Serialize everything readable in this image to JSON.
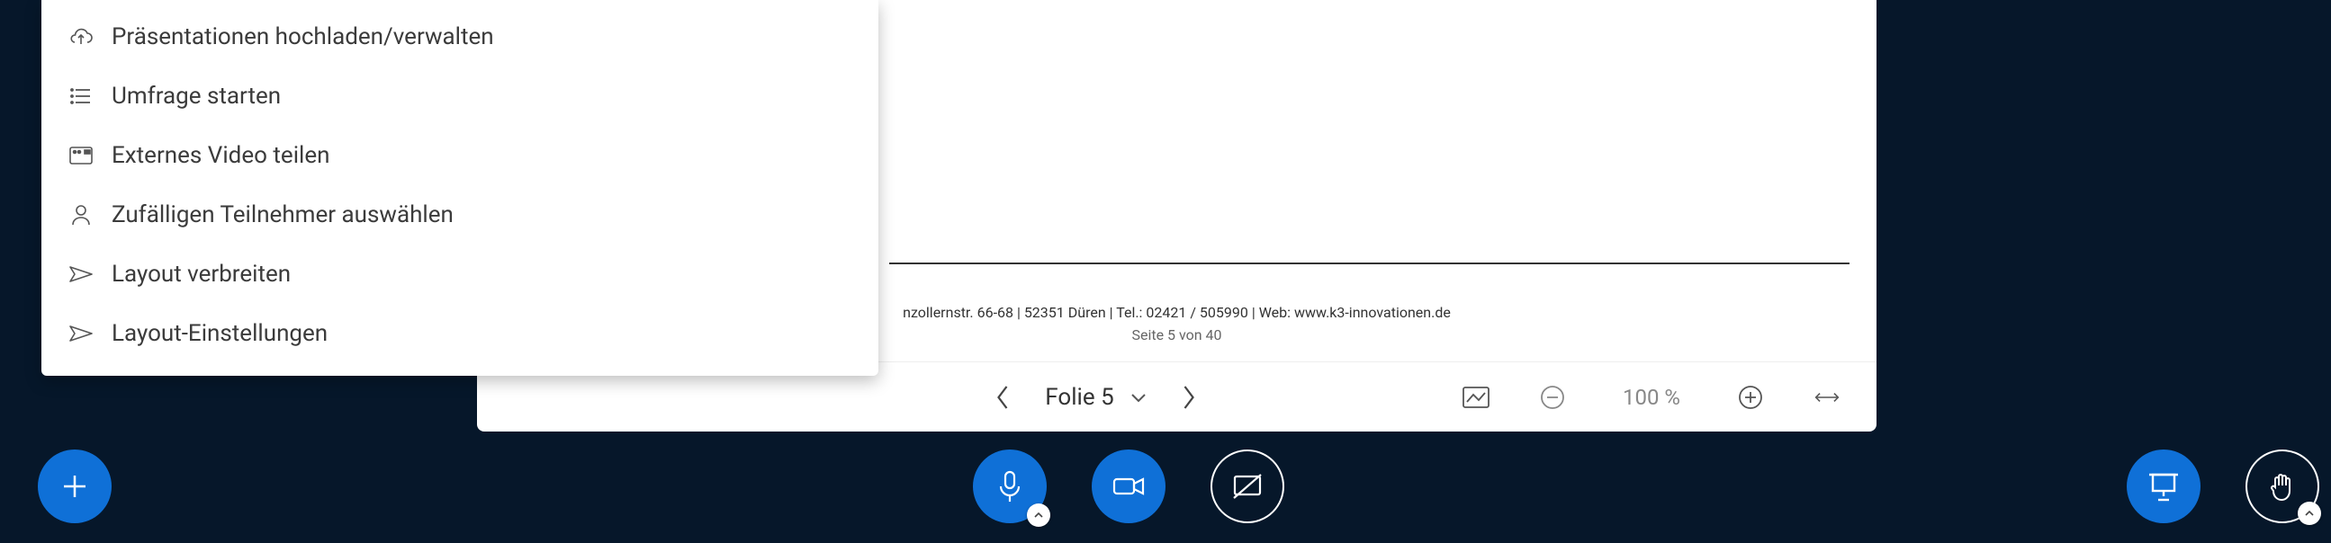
{
  "menu": {
    "items": [
      {
        "label": "Präsentationen hochladen/verwalten",
        "icon": "upload-cloud-icon"
      },
      {
        "label": "Umfrage starten",
        "icon": "poll-list-icon"
      },
      {
        "label": "Externes Video teilen",
        "icon": "external-video-icon"
      },
      {
        "label": "Zufälligen Teilnehmer auswählen",
        "icon": "random-user-icon"
      },
      {
        "label": "Layout verbreiten",
        "icon": "send-layout-icon"
      },
      {
        "label": "Layout-Einstellungen",
        "icon": "layout-settings-icon"
      }
    ]
  },
  "slide": {
    "footer_text": "nzollernstr. 66-68  |  52351 Düren  |  Tel.: 02421 / 505990  |  Web: www.k3-innovationen.de",
    "page_indicator": "Seite 5 von 40",
    "current_slide_label": "Folie 5",
    "zoom_label": "100 %"
  },
  "colors": {
    "background": "#06172a",
    "accent": "#0f70d7"
  }
}
